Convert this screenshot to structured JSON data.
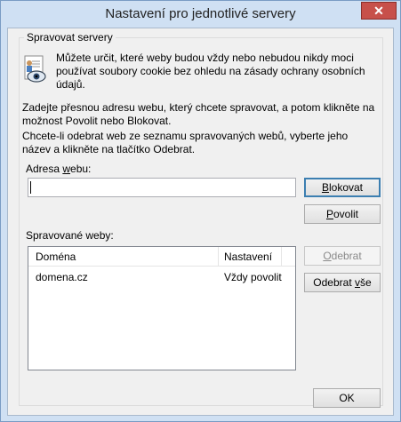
{
  "window": {
    "title": "Nastavení pro jednotlivé servery",
    "close_label": "✕"
  },
  "group": {
    "label": "Spravovat servery"
  },
  "info": {
    "icon": "privacy-eye-document-icon",
    "text": "Můžete určit, které weby budou vždy nebo nebudou nikdy moci používat soubory cookie bez ohledu na zásady ochrany osobních údajů."
  },
  "instructions": {
    "line1": "Zadejte přesnou adresu webu, který chcete spravovat, a potom klikněte na možnost Povolit nebo Blokovat.",
    "line2": "Chcete-li odebrat web ze seznamu spravovaných webů, vyberte jeho název a klikněte na tlačítko Odebrat."
  },
  "address": {
    "label_pre": "Adresa ",
    "label_accel": "w",
    "label_post": "ebu:",
    "value": ""
  },
  "buttons": {
    "block": {
      "accel": "B",
      "rest": "lokovat"
    },
    "allow": {
      "accel": "P",
      "rest": "ovolit"
    },
    "remove": {
      "accel": "O",
      "rest": "debrat"
    },
    "remove_all": {
      "pre": "Odebrat ",
      "accel": "v",
      "rest": "še"
    },
    "ok": "OK"
  },
  "managed": {
    "label": "Spravované weby:",
    "columns": [
      "Doména",
      "Nastavení"
    ],
    "rows": [
      {
        "domain": "domena.cz",
        "setting": "Vždy povolit"
      }
    ]
  }
}
